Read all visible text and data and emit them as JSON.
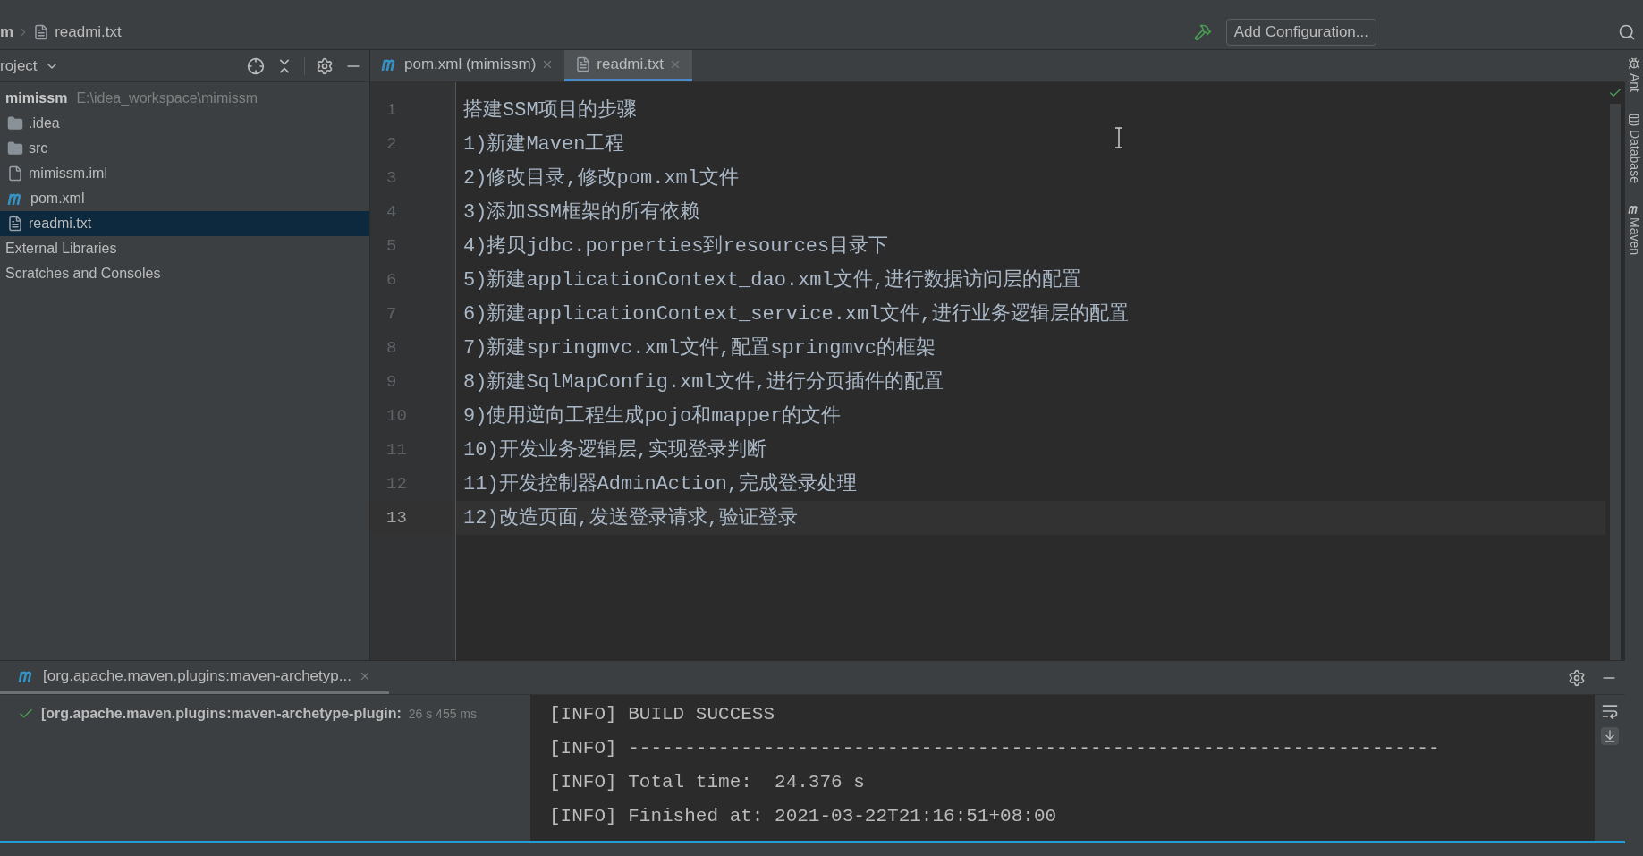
{
  "breadcrumb": [
    "m",
    "readmi.txt"
  ],
  "toolbar": {
    "run_config": "Add Configuration..."
  },
  "project_panel": {
    "title": "roject",
    "tree": [
      {
        "name": "mimissm",
        "path": "E:\\idea_workspace\\mimissm",
        "kind": "module",
        "selected": false,
        "children": [
          {
            "name": ".idea",
            "kind": "folder",
            "selected": false
          },
          {
            "name": "src",
            "kind": "folder",
            "selected": false
          },
          {
            "name": "mimissm.iml",
            "kind": "iml",
            "selected": false
          },
          {
            "name": "pom.xml",
            "kind": "maven",
            "selected": false
          },
          {
            "name": "readmi.txt",
            "kind": "text",
            "selected": true
          }
        ]
      },
      {
        "name": "External Libraries",
        "kind": "group",
        "selected": false
      },
      {
        "name": "Scratches and Consoles",
        "kind": "group",
        "selected": false
      }
    ]
  },
  "editor_tabs": [
    {
      "label": "pom.xml (mimissm)",
      "kind": "maven",
      "selected": false
    },
    {
      "label": "readmi.txt",
      "kind": "text",
      "selected": true
    }
  ],
  "editor_lines": [
    {
      "number": "1",
      "text": "搭建SSM项目的步骤",
      "current": false
    },
    {
      "number": "2",
      "text": "1)新建Maven工程",
      "current": false
    },
    {
      "number": "3",
      "text": "2)修改目录,修改pom.xml文件",
      "current": false
    },
    {
      "number": "4",
      "text": "3)添加SSM框架的所有依赖",
      "current": false
    },
    {
      "number": "5",
      "text": "4)拷贝jdbc.porperties到resources目录下",
      "current": false
    },
    {
      "number": "6",
      "text": "5)新建applicationContext_dao.xml文件,进行数据访问层的配置",
      "current": false
    },
    {
      "number": "7",
      "text": "6)新建applicationContext_service.xml文件,进行业务逻辑层的配置",
      "current": false
    },
    {
      "number": "8",
      "text": "7)新建springmvc.xml文件,配置springmvc的框架",
      "current": false
    },
    {
      "number": "9",
      "text": "8)新建SqlMapConfig.xml文件,进行分页插件的配置",
      "current": false
    },
    {
      "number": "10",
      "text": "9)使用逆向工程生成pojo和mapper的文件",
      "current": false
    },
    {
      "number": "11",
      "text": "10)开发业务逻辑层,实现登录判断",
      "current": false
    },
    {
      "number": "12",
      "text": "11)开发控制器AdminAction,完成登录处理",
      "current": false
    },
    {
      "number": "13",
      "text": "12)改造页面,发送登录请求,验证登录",
      "current": true
    }
  ],
  "right_tools": [
    "Ant",
    "Database",
    "Maven"
  ],
  "run_panel": {
    "tab": "[org.apache.maven.plugins:maven-archetyp...",
    "task": {
      "label": "[org.apache.maven.plugins:maven-archetype-plugin:",
      "time": "26 s 455 ms",
      "succeeded": true
    },
    "console": [
      "[INFO] BUILD SUCCESS",
      "[INFO] ------------------------------------------------------------------------",
      "[INFO] Total time:  24.376 s",
      "[INFO] Finished at: 2021-03-22T21:16:51+08:00"
    ]
  }
}
